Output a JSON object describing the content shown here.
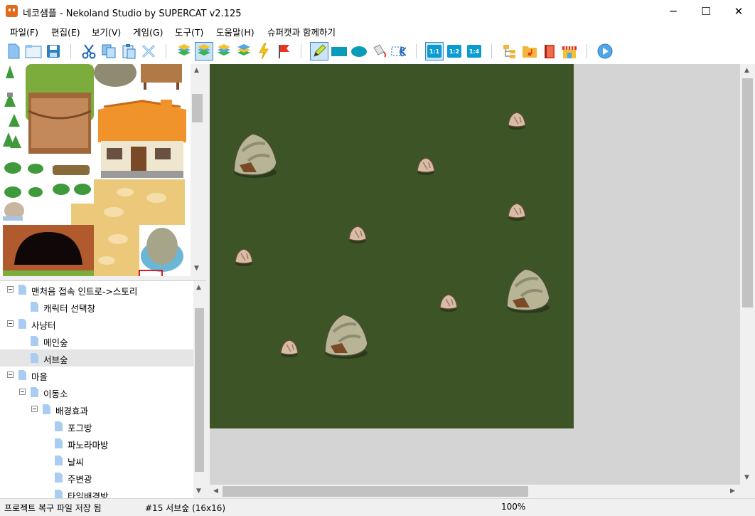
{
  "window": {
    "title": "네코샘플 - Nekoland Studio by SUPERCAT v2.125",
    "minimize_glyph": "─",
    "maximize_glyph": "☐",
    "close_glyph": "✕"
  },
  "menu": [
    "파일(F)",
    "편집(E)",
    "보기(V)",
    "게임(G)",
    "도구(T)",
    "도움말(H)",
    "슈퍼캣과 함께하기"
  ],
  "toolbar": {
    "zoom_1": "1:1",
    "zoom_2": "1:2",
    "zoom_4": "1:4",
    "icons": [
      "new-file-icon",
      "open-folder-icon",
      "save-icon",
      "cut-icon",
      "copy-icon",
      "paste-icon",
      "delete-icon",
      "layer-all-icon",
      "layer-1-icon",
      "layer-2-icon",
      "layer-3-icon",
      "event-icon",
      "start-point-icon",
      "pencil-icon",
      "rectangle-icon",
      "ellipse-icon",
      "fill-icon",
      "select-icon",
      "zoom-1-1-icon",
      "zoom-1-2-icon",
      "zoom-1-4-icon",
      "map-tree-icon",
      "sound-folder-icon",
      "resource-book-icon",
      "shop-icon",
      "play-icon"
    ],
    "accent": "#0a9bd2"
  },
  "tree": [
    {
      "label": "맨처음 접속 인트로->스토리",
      "depth": 0,
      "toggle": true
    },
    {
      "label": "캐릭터 선택창",
      "depth": 1,
      "toggle": false
    },
    {
      "label": "사냥터",
      "depth": 0,
      "toggle": true
    },
    {
      "label": "메인숲",
      "depth": 1,
      "toggle": false
    },
    {
      "label": "서브숲",
      "depth": 1,
      "toggle": false,
      "selected": true
    },
    {
      "label": "마을",
      "depth": 0,
      "toggle": true
    },
    {
      "label": "이동소",
      "depth": 1,
      "toggle": true
    },
    {
      "label": "배경효과",
      "depth": 2,
      "toggle": true
    },
    {
      "label": "포그방",
      "depth": 3,
      "toggle": false
    },
    {
      "label": "파노라마방",
      "depth": 3,
      "toggle": false
    },
    {
      "label": "날씨",
      "depth": 3,
      "toggle": false
    },
    {
      "label": "주변광",
      "depth": 3,
      "toggle": false
    },
    {
      "label": "타일배경방",
      "depth": 3,
      "toggle": false
    }
  ],
  "map": {
    "ground_color": "#3d5526"
  },
  "status": {
    "message": "프로젝트 복구 파일 저장 됨",
    "map_info": "#15 서브숲 (16x16)",
    "zoom": "100%"
  }
}
